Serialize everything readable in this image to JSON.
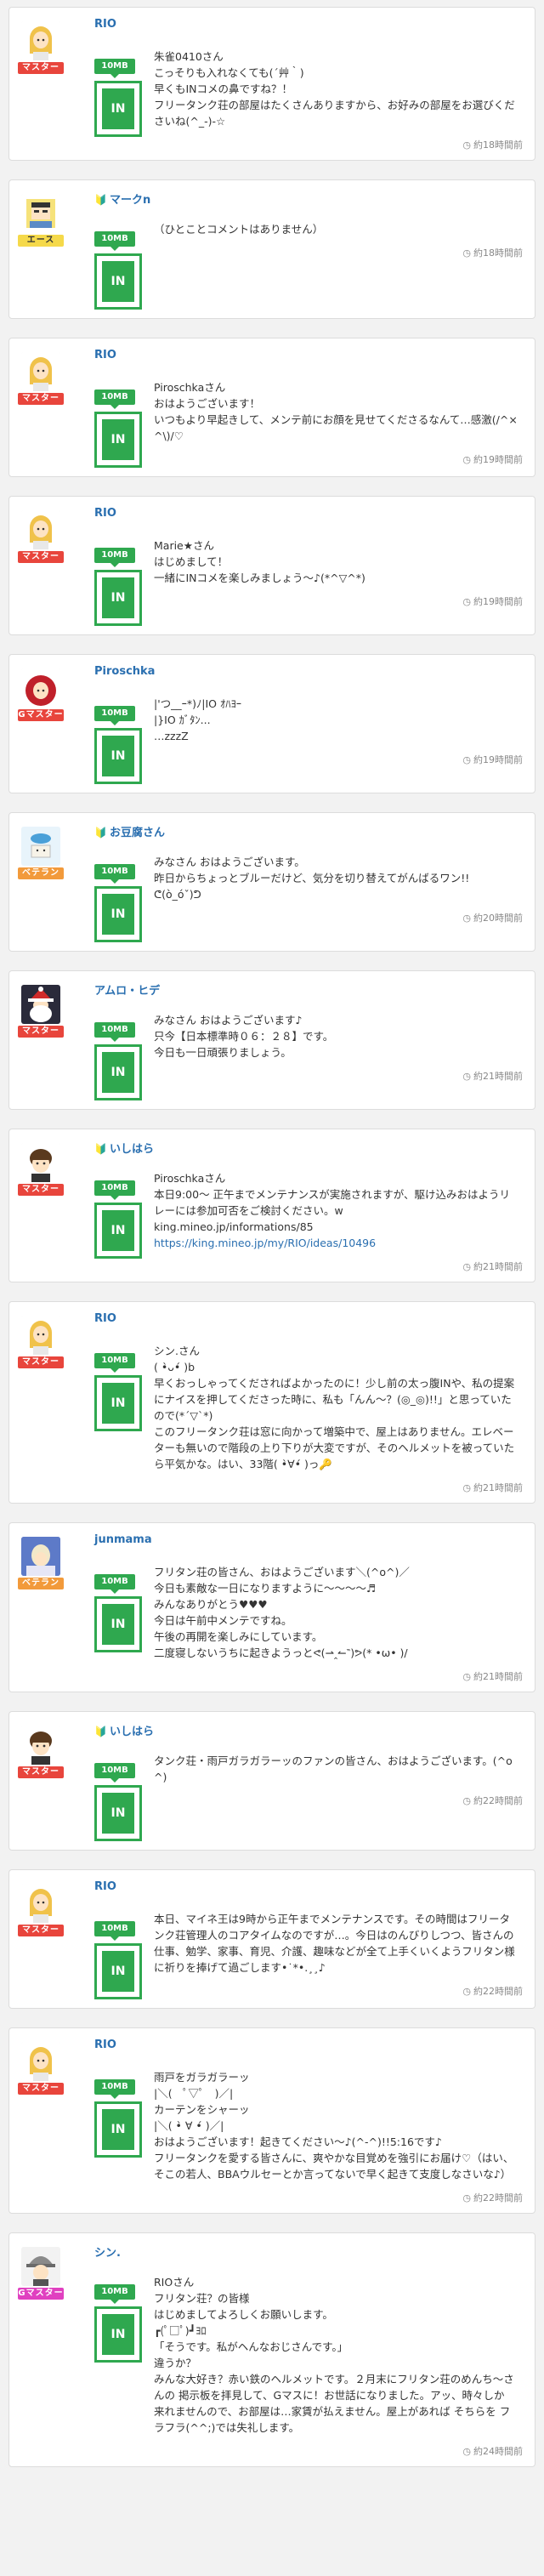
{
  "posts": [
    {
      "user": "RIO",
      "rank": "マスター",
      "rank_class": "master",
      "quota": "10MB",
      "in": "IN",
      "beginner": false,
      "avatar": "rio",
      "body": "朱雀0410さん\nこっそりも入れなくても(´艸｀)\n早くもINコメの鼻ですね？！\nフリータンク荘の部屋はたくさんありますから、お好みの部屋をお選びくださいね(^_-)-☆",
      "time": "約18時間前"
    },
    {
      "user": "マークn",
      "rank": "エース",
      "rank_class": "ace",
      "quota": "10MB",
      "in": "IN",
      "beginner": true,
      "avatar": "markn",
      "body": "（ひとことコメントはありません）",
      "time": "約18時間前"
    },
    {
      "user": "RIO",
      "rank": "マスター",
      "rank_class": "master",
      "quota": "10MB",
      "in": "IN",
      "beginner": false,
      "avatar": "rio",
      "body": "Piroschkaさん\nおはようございます！\nいつもより早起きして、メンテ前にお顔を見せてくださるなんて…感激(/^×^\\)/♡",
      "time": "約19時間前"
    },
    {
      "user": "RIO",
      "rank": "マスター",
      "rank_class": "master",
      "quota": "10MB",
      "in": "IN",
      "beginner": false,
      "avatar": "rio",
      "body": "Marie★さん\nはじめまして！\n一緒にINコメを楽しみましょう〜♪(*^▽^*)",
      "time": "約19時間前"
    },
    {
      "user": "Piroschka",
      "rank": "Gマスター",
      "rank_class": "master",
      "quota": "10MB",
      "in": "IN",
      "beginner": false,
      "avatar": "piro",
      "body": "|'つ__ｰ*)ﾉ|IO ｵﾊﾖｰ\n|}IO ｶﾞﾀﾝ...\n…zzzZ",
      "time": "約19時間前"
    },
    {
      "user": "お豆腐さん",
      "rank": "ベテラン",
      "rank_class": "veteran",
      "quota": "10MB",
      "in": "IN",
      "beginner": true,
      "avatar": "tofu",
      "body": "みなさん おはようございます。\n昨日からちょっとブルーだけど、気分を切り替えてがんばるワン!!\nᕦ(ò_óˇ)ᕤ",
      "time": "約20時間前"
    },
    {
      "user": "アムロ・ヒデ",
      "rank": "マスター",
      "rank_class": "master",
      "quota": "10MB",
      "in": "IN",
      "beginner": false,
      "avatar": "santa",
      "body": "みなさん おはようございます♪\n只今【日本標準時０６：２８】です。\n今日も一日頑張りましょう。",
      "time": "約21時間前"
    },
    {
      "user": "いしはら",
      "rank": "マスター",
      "rank_class": "master",
      "quota": "10MB",
      "in": "IN",
      "beginner": true,
      "avatar": "ishi",
      "body": "Piroschkaさん\n本日9:00〜 正午までメンテナンスが実施されますが、駆け込みおはようリレーには参加可否をご検討ください。w\nking.mineo.jp/informations/85\n",
      "link": "https://king.mineo.jp/my/RIO/ideas/10496",
      "time": "約21時間前"
    },
    {
      "user": "RIO",
      "rank": "マスター",
      "rank_class": "master",
      "quota": "10MB",
      "in": "IN",
      "beginner": false,
      "avatar": "rio",
      "body": "シン.さん\n( •̀ᴗ•́ )b\n早くおっしゃってくださればよかったのに！少し前の太っ腹INや、私の提案にナイスを押してくださった時に、私も「んん〜？(◎_◎)!!」と思っていたので(*´▽`*)\nこのフリータンク荘は窓に向かって増築中で、屋上はありません。エレベーターも無いので階段の上り下りが大変ですが、そのヘルメットを被っていたら平気かな。はい、33階( •̀∀•́ )っ🔑",
      "time": "約21時間前"
    },
    {
      "user": "junmama",
      "rank": "ベテラン",
      "rank_class": "veteran",
      "quota": "10MB",
      "in": "IN",
      "beginner": false,
      "avatar": "jun",
      "body": "フリタン荘の皆さん、おはようございます＼(^o^)／\n今日も素敵な一日になりますように〜〜〜〜♬\nみんなありがとう♥♥♥\n今日は午前中メンテですね。\n午後の再開を楽しみにしています。\n二度寝しないうちに起きようっとᕙ(⇀‸↼‶)ᕗ(* •ω• )/",
      "time": "約21時間前"
    },
    {
      "user": "いしはら",
      "rank": "マスター",
      "rank_class": "master",
      "quota": "10MB",
      "in": "IN",
      "beginner": true,
      "avatar": "ishi",
      "body": "タンク荘・雨戸ガラガラーッのファンの皆さん、おはようございます。(^o^)",
      "time": "約22時間前"
    },
    {
      "user": "RIO",
      "rank": "マスター",
      "rank_class": "master",
      "quota": "10MB",
      "in": "IN",
      "beginner": false,
      "avatar": "rio",
      "body": "本日、マイネ王は9時から正午までメンテナンスです。その時間はフリータンク荘管理人のコアタイムなのですが…。今日はのんびりしつつ、皆さんの仕事、勉学、家事、育児、介護、趣味などが全て上手くいくようフリタン様に祈りを捧げて過ごします•˙*•.¸¸♪",
      "time": "約22時間前"
    },
    {
      "user": "RIO",
      "rank": "マスター",
      "rank_class": "master",
      "quota": "10MB",
      "in": "IN",
      "beginner": false,
      "avatar": "rio",
      "body": "雨戸をガラガラーッ\n|＼(　ﾟ▽ﾟ　)／|\nカーテンをシャーッ\n|＼( •̀ ∀ •́ )／|\nおはようございます！起きてください〜♪(^-^)!!5:16です♪\nフリータンクを愛する皆さんに、爽やかな目覚めを強引にお届け♡（はい、そこの若人、BBAウルセーとか言ってないで早く起きて支度しなさいな♪）",
      "time": "約22時間前"
    },
    {
      "user": "シン.",
      "rank": "Gマスター",
      "rank_class": "gmaster",
      "quota": "10MB",
      "in": "IN",
      "beginner": false,
      "avatar": "shin",
      "body": "RIOさん\nフリタン荘？の皆様\nはじめましてよろしくお願いします。\n┏(ﾟ□ﾟ)┛ﾖﾛ\n「そうです。私がヘんなおじさんです。」\n違うか？\nみんな大好き？赤い鉄のヘルメットです。２月末にフリタン荘のめんち〜さんの 掲示板を拝見して、Gマスに！お世話になりました。アッ、時々しか 来れませんので、お部屋は…家賃が払えません。屋上があれば そちらを フラフラ(^^;)では失礼します。",
      "time": "約24時間前"
    }
  ]
}
